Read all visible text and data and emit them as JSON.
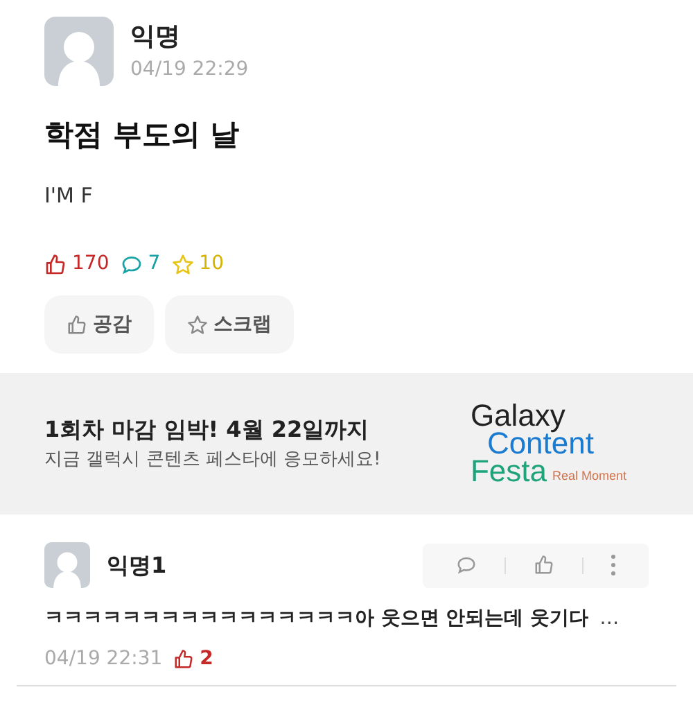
{
  "post": {
    "author": "익명",
    "time": "04/19 22:29",
    "title": "학점 부도의 날",
    "body": "I'M F",
    "likes": "170",
    "comments": "7",
    "scraps": "10",
    "buttons": [
      "공감",
      "스크랩"
    ]
  },
  "banner": {
    "headline": "1회차 마감 임박! 4월 22일까지",
    "subline": "지금 갤럭시 콘텐츠 페스타에 응모하세요!",
    "logo": [
      "Galaxy",
      "Content",
      "Festa"
    ],
    "tagline": "Real Moment"
  },
  "comments": [
    {
      "author": "익명1",
      "text": "ㅋㅋㅋㅋㅋㅋㅋㅋㅋㅋㅋㅋㅋㅋㅋㅋ아 웃으면 안되는데 웃기다",
      "more": "…",
      "time": "04/19 22:31",
      "likes": "2"
    }
  ]
}
